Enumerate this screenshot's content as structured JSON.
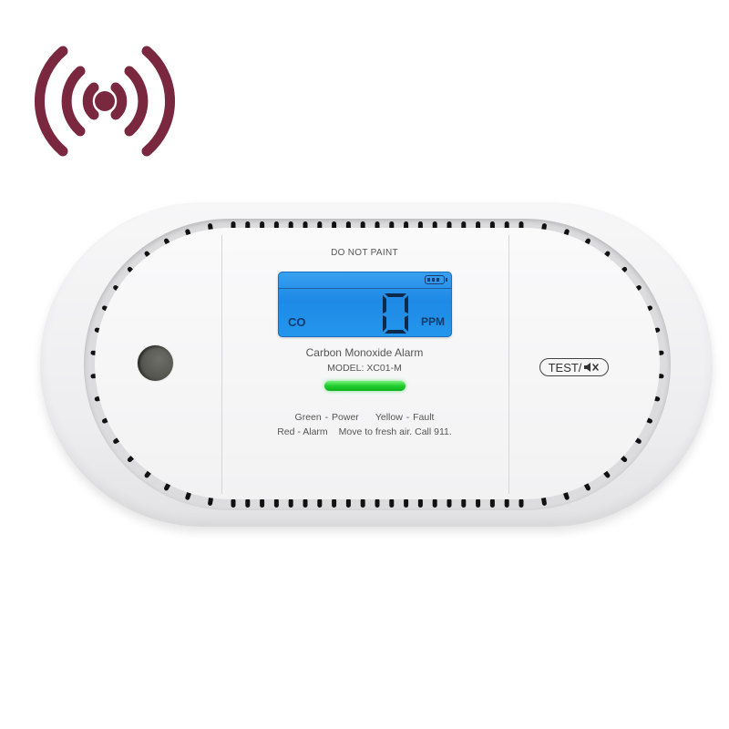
{
  "image": {
    "subject": "Carbon monoxide alarm product photo",
    "signal_icon": "wireless-signal-icon",
    "colors": {
      "signal_icon": "#7a2840",
      "lcd_background": "#2596ec",
      "lcd_text": "#123a6a",
      "led": "#1fcf2c",
      "body": "#f2f2f3"
    }
  },
  "device": {
    "top_label": "DO NOT PAINT",
    "lcd": {
      "left_label": "CO",
      "reading": "0",
      "unit_label": "PPM",
      "battery_icon": "battery-full-icon",
      "battery_bars": 3
    },
    "title": "Carbon Monoxide Alarm",
    "model": "MODEL: XC01-M",
    "led_status": "green",
    "legend": {
      "green": "Green - Power",
      "yellow": "Yellow - Fault",
      "red": "Red - Alarm",
      "instruction": "Move to fresh air. Call 911."
    },
    "test_button": {
      "label": "TEST/",
      "icon": "mute-icon"
    }
  }
}
